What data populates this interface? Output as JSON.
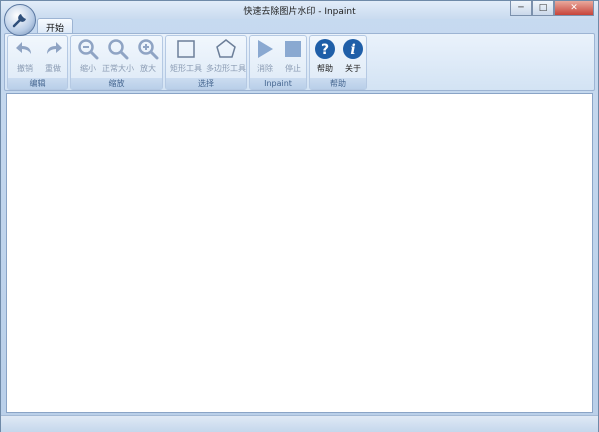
{
  "window": {
    "title": "快速去除图片水印 - Inpaint",
    "controls": {
      "minimize": "─",
      "maximize": "□",
      "close": "✕"
    }
  },
  "tabs": [
    {
      "label": "开始",
      "active": true
    }
  ],
  "ribbon": {
    "groups": [
      {
        "label": "编辑",
        "buttons": [
          {
            "label": "撤销",
            "icon": "undo-icon",
            "enabled": false
          },
          {
            "label": "重做",
            "icon": "redo-icon",
            "enabled": false
          }
        ]
      },
      {
        "label": "缩放",
        "buttons": [
          {
            "label": "缩小",
            "icon": "zoom-out-icon",
            "enabled": false
          },
          {
            "label": "正常大小",
            "icon": "zoom-normal-icon",
            "enabled": false
          },
          {
            "label": "放大",
            "icon": "zoom-in-icon",
            "enabled": false
          }
        ]
      },
      {
        "label": "选择",
        "buttons": [
          {
            "label": "矩形工具",
            "icon": "rectangle-icon",
            "enabled": false
          },
          {
            "label": "多边形工具",
            "icon": "polygon-icon",
            "enabled": false
          }
        ]
      },
      {
        "label": "Inpaint",
        "buttons": [
          {
            "label": "消除",
            "icon": "play-icon",
            "enabled": false
          },
          {
            "label": "停止",
            "icon": "stop-icon",
            "enabled": false
          }
        ]
      },
      {
        "label": "帮助",
        "buttons": [
          {
            "label": "帮助",
            "icon": "help-icon",
            "enabled": true
          },
          {
            "label": "关于",
            "icon": "info-icon",
            "enabled": true
          }
        ]
      }
    ]
  },
  "colors": {
    "frame": "#c7daf0",
    "ribbon": "#dde9f6",
    "canvas": "#ffffff",
    "help_blue": "#1f5fa8"
  }
}
